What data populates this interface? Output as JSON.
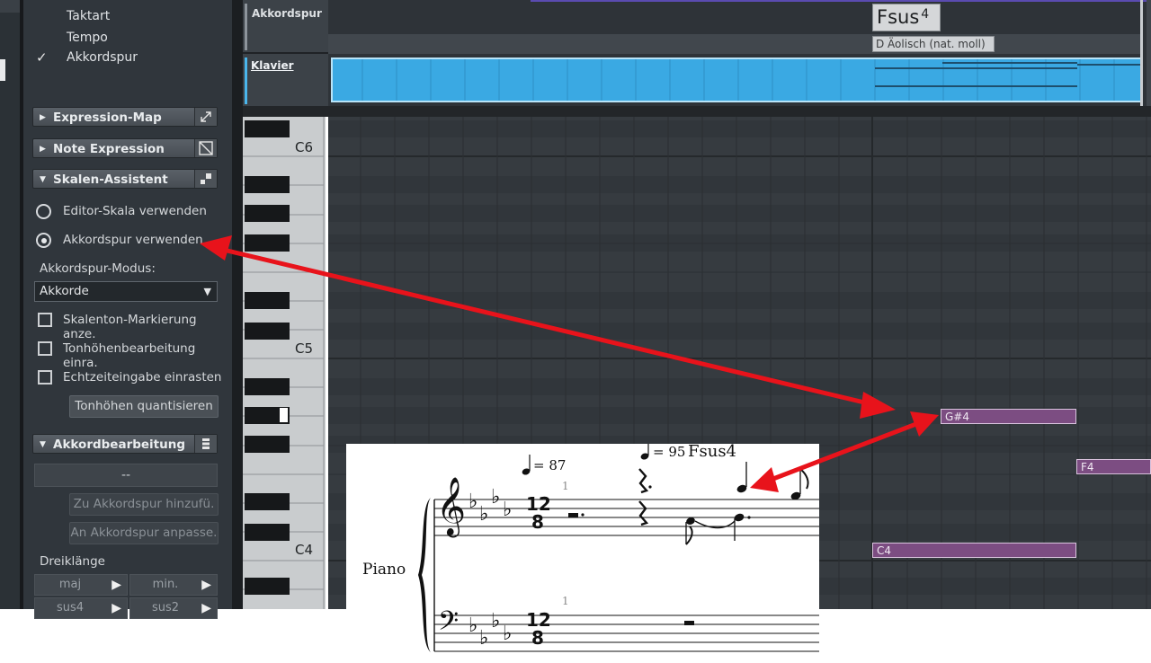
{
  "inspector": {
    "menu_items": [
      {
        "label": "Taktart",
        "checked": false
      },
      {
        "label": "Tempo",
        "checked": false
      },
      {
        "label": "Akkordspur",
        "checked": true
      }
    ],
    "checkmark": "✓",
    "sections": {
      "expression_map": {
        "label": "Expression-Map",
        "arrow": "▶",
        "icon": "expand-icon"
      },
      "note_expression": {
        "label": "Note Expression",
        "arrow": "▶",
        "icon": "note-expression-icon"
      },
      "scale_assistant": {
        "label": "Skalen-Assistent",
        "arrow": "▼",
        "icon": "scale-assistant-icon"
      },
      "chord_editing": {
        "label": "Akkordbearbeitung",
        "arrow": "▼",
        "icon": "chord-editing-icon"
      }
    },
    "scale_options": {
      "editor_scale": {
        "label": "Editor-Skala verwenden",
        "selected": false
      },
      "chord_track": {
        "label": "Akkordspur verwenden",
        "selected": true
      }
    },
    "mode_label": "Akkordspur-Modus:",
    "mode_value": "Akkorde",
    "dropdown_arrow": "▼",
    "checkboxes": [
      {
        "label": "Skalenton-Markierung anze.",
        "checked": false
      },
      {
        "label": "Tonhöhenbearbeitung einra.",
        "checked": false
      },
      {
        "label": "Echtzeiteingabe einrasten",
        "checked": false
      }
    ],
    "quantize_button": "Tonhöhen quantisieren",
    "chord_field": "--",
    "add_to_track_button": "Zu Akkordspur hinzufü.",
    "adapt_to_track_button": "An Akkordspur anpasse.",
    "triads_label": "Dreiklänge",
    "triads": [
      {
        "label": "maj",
        "arrow": "▶"
      },
      {
        "label": "min.",
        "arrow": "▶"
      },
      {
        "label": "sus4",
        "arrow": "▶"
      },
      {
        "label": "sus2",
        "arrow": "▶"
      }
    ]
  },
  "tracks": [
    {
      "name": "Akkordspur",
      "color": "#8d949b"
    },
    {
      "name": "Klavier",
      "color": "#4ab6ec"
    }
  ],
  "chord_track": {
    "chord_root": "Fsus",
    "chord_ext": "4",
    "scale": "D Äolisch (nat. moll)"
  },
  "keyboard": {
    "labels": [
      "C6",
      "C5",
      "C4"
    ]
  },
  "notes": [
    {
      "label": "G#4",
      "color": "#7c4d82"
    },
    {
      "label": "F4",
      "color": "#7c4d82"
    },
    {
      "label": "C4",
      "color": "#7c4d82"
    }
  ],
  "score": {
    "instrument": "Piano",
    "tempo_1": "= 87",
    "tempo_2": "= 95",
    "chord_symbol": "Fsus4",
    "measure_number_treble": "1",
    "measure_number_bass": "1",
    "time_sig_num": "12",
    "time_sig_den": "8",
    "treble_clef": "𝄞",
    "bass_clef": "𝄢",
    "flat": "♭"
  },
  "colors": {
    "arrow": "#e8131b",
    "midi_part": "#3aa9e3",
    "note": "#7c4d82"
  }
}
